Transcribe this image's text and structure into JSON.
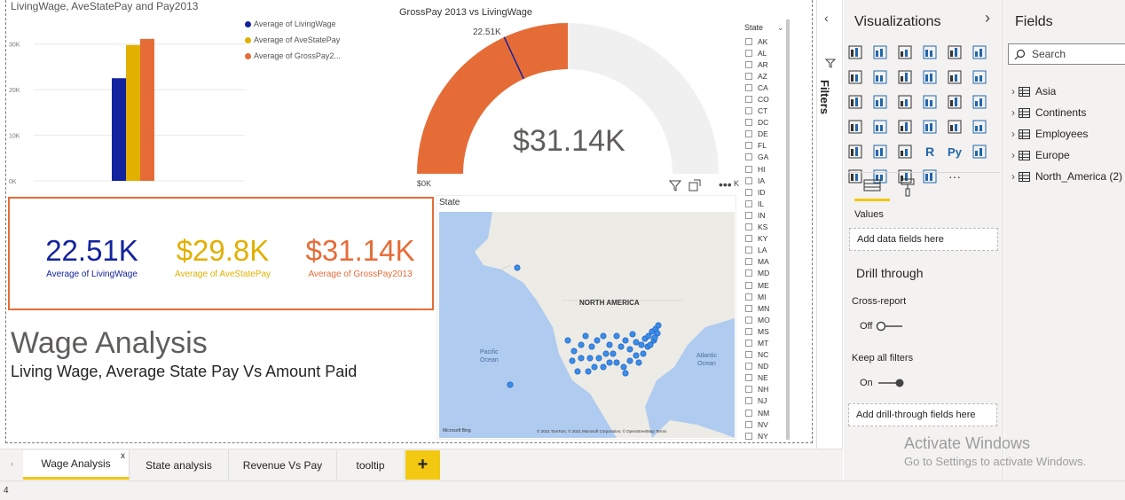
{
  "report": {
    "bar_chart": {
      "title": "LivingWage, AveStatePay and Pay2013",
      "y_ticks": [
        "30K",
        "20K",
        "10K",
        "0K"
      ],
      "legend": [
        {
          "label": "Average of LivingWage",
          "color": "#12239E"
        },
        {
          "label": "Average of AveStatePay",
          "color": "#E1B000"
        },
        {
          "label": "Average of GrossPay2...",
          "color": "#E66C37"
        }
      ]
    },
    "gauge": {
      "title": "GrossPay 2013 vs LivingWage",
      "value_label": "$31.14K",
      "target_label": "22.51K",
      "min_label": "$0K",
      "max_label": "K",
      "fill_color": "#E66C37",
      "track_color": "#F0F0F0",
      "target_color": "#12239E"
    },
    "cards": [
      {
        "value": "22.51K",
        "label": "Average of LivingWage",
        "color": "#12239E"
      },
      {
        "value": "$29.8K",
        "label": "Average of AveStatePay",
        "color": "#E1B000"
      },
      {
        "value": "$31.14K",
        "label": "Average of GrossPay2013",
        "color": "#E66C37"
      }
    ],
    "text_box": {
      "title": "Wage Analysis",
      "subtitle": "Living Wage, Average State Pay Vs Amount Paid"
    },
    "map": {
      "title": "State",
      "continent_label": "NORTH AMERICA",
      "ocean_left": "Pacific\nOcean",
      "ocean_left_1": "Pacific",
      "ocean_left_2": "Ocean",
      "ocean_right_1": "Atlantic",
      "ocean_right_2": "Ocean",
      "logo": "Microsoft Bing",
      "copyright": "© 2021 TomTom, © 2021 Microsoft Corporation, © OpenStreetMap  Terms"
    },
    "slicer": {
      "title": "State",
      "items": [
        "AK",
        "AL",
        "AR",
        "AZ",
        "CA",
        "CO",
        "CT",
        "DC",
        "DE",
        "FL",
        "GA",
        "HI",
        "IA",
        "ID",
        "IL",
        "IN",
        "KS",
        "KY",
        "LA",
        "MA",
        "MD",
        "ME",
        "MI",
        "MN",
        "MO",
        "MS",
        "MT",
        "NC",
        "ND",
        "NE",
        "NH",
        "NJ",
        "NM",
        "NV",
        "NY"
      ]
    }
  },
  "chart_data": [
    {
      "type": "bar",
      "title": "LivingWage, AveStatePay and Pay2013",
      "categories": [
        ""
      ],
      "series": [
        {
          "name": "Average of LivingWage",
          "values": [
            22510
          ]
        },
        {
          "name": "Average of AveStatePay",
          "values": [
            29800
          ]
        },
        {
          "name": "Average of GrossPay2...",
          "values": [
            31140
          ]
        }
      ],
      "ylim": [
        0,
        35000
      ],
      "grid": true,
      "legend": "right"
    },
    {
      "type": "gauge",
      "title": "GrossPay 2013 vs LivingWage",
      "value": 31140,
      "target": 22510,
      "min": 0,
      "max": 31140
    }
  ],
  "filters_pane": {
    "label": "Filters"
  },
  "viz_pane": {
    "title": "Visualizations",
    "icons": [
      "stacked-bar-icon",
      "stacked-column-icon",
      "clustered-bar-icon",
      "clustered-column-icon",
      "100-bar-icon",
      "100-column-icon",
      "line-chart-icon",
      "area-chart-icon",
      "stacked-area-icon",
      "line-column-icon",
      "line-clustered-icon",
      "ribbon-chart-icon",
      "waterfall-icon",
      "funnel-icon",
      "scatter-icon",
      "pie-icon",
      "donut-icon",
      "treemap-icon",
      "map-icon",
      "filled-map-icon",
      "gauge-icon",
      "card-icon",
      "multirow-card-icon",
      "kpi-icon",
      "slicer-icon",
      "table-icon",
      "matrix-icon",
      "r-visual-icon",
      "python-visual-icon",
      "key-influencers-icon",
      "decomposition-tree-icon",
      "qa-icon",
      "smart-narrative-icon",
      "paginated-report-icon",
      "more-icon"
    ],
    "values_label": "Values",
    "add_fields_placeholder": "Add data fields here",
    "drill_title": "Drill through",
    "cross_report_label": "Cross-report",
    "cross_report_state": "Off",
    "keep_filters_label": "Keep all filters",
    "keep_filters_state": "On",
    "drill_placeholder": "Add drill-through fields here"
  },
  "fields_pane": {
    "title": "Fields",
    "search_placeholder": "Search",
    "tables": [
      "Asia",
      "Continents",
      "Employees",
      "Europe",
      "North_America (2)"
    ]
  },
  "tabs": [
    {
      "label": "Wage Analysis",
      "active": true
    },
    {
      "label": "State analysis",
      "active": false
    },
    {
      "label": "Revenue Vs Pay",
      "active": false
    },
    {
      "label": "tooltip",
      "active": false
    }
  ],
  "tab_close": "x",
  "add_page": "+",
  "status_bar": {
    "page_count": "4"
  },
  "watermark": {
    "line1": "Activate Windows",
    "line2": "Go to Settings to activate Windows."
  }
}
